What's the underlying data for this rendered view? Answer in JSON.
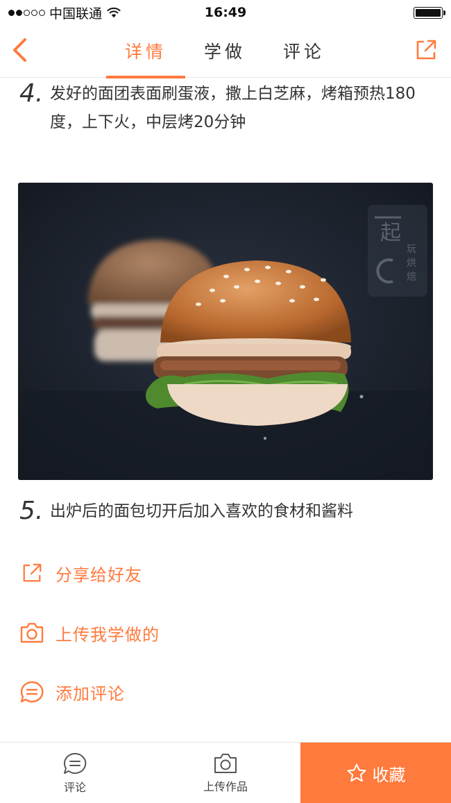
{
  "status_bar": {
    "carrier": "中国联通",
    "time": "16:49"
  },
  "nav": {
    "tabs": [
      {
        "label": "详情",
        "active": true
      },
      {
        "label": "学做",
        "active": false
      },
      {
        "label": "评论",
        "active": false
      }
    ]
  },
  "steps": [
    {
      "number": "4.",
      "text": "发好的面团表面刷蛋液，撒上白芝麻，烤箱预热180度，上下火，中层烤20分钟"
    },
    {
      "number": "5.",
      "text": "出炉后的面包切开后加入喜欢的食材和酱料"
    }
  ],
  "photo": {
    "watermark": "一起玩烘焙"
  },
  "actions": {
    "share": "分享给好友",
    "upload": "上传我学做的",
    "comment": "添加评论"
  },
  "bottom_bar": {
    "comment": "评论",
    "upload": "上传作品",
    "favorite": "收藏"
  },
  "colors": {
    "accent": "#ff7a3d"
  }
}
